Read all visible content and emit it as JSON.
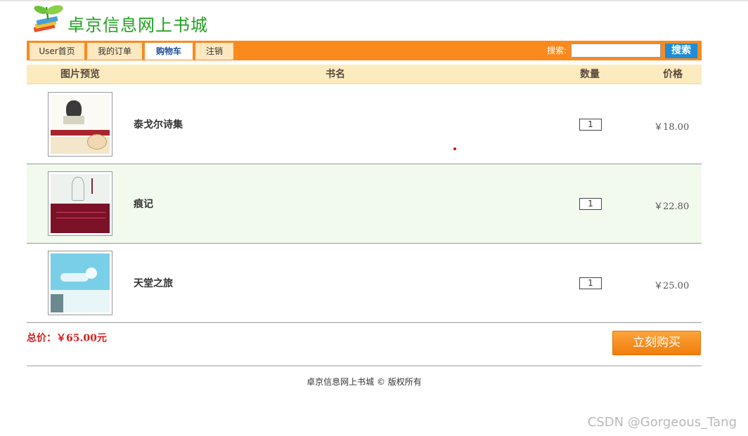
{
  "brand": {
    "name": "卓京信息网上书城",
    "logo_icon": "sprout-books-icon"
  },
  "nav": {
    "tabs": [
      {
        "label": "User首页",
        "active": false
      },
      {
        "label": "我的订单",
        "active": false
      },
      {
        "label": "购物车",
        "active": true
      },
      {
        "label": "注销",
        "active": false
      }
    ],
    "search": {
      "label": "搜索:",
      "value": "",
      "button": "搜索"
    }
  },
  "cart": {
    "columns": [
      "图片预览",
      "书名",
      "数量",
      "价格"
    ],
    "items": [
      {
        "title": "泰戈尔诗集",
        "quantity": "1",
        "price": "￥18.00",
        "cover": "tagore-poems-cover"
      },
      {
        "title": "痕记",
        "quantity": "1",
        "price": "￥22.80",
        "cover": "henji-cover"
      },
      {
        "title": "天堂之旅",
        "quantity": "1",
        "price": "￥25.00",
        "cover": "tiantang-cover"
      }
    ],
    "total_label": "总价：￥65.00元",
    "buy_button": "立刻购买"
  },
  "footer": {
    "copyright": "卓京信息网上书城 © 版权所有"
  },
  "watermark": "CSDN @Gorgeous_Tang",
  "colors": {
    "nav_bg": "#fb8a1e",
    "header_bg": "#fdebc0",
    "brand_green": "#1fa21f",
    "total_red": "#d62020",
    "buy_orange": "#f5891a"
  }
}
